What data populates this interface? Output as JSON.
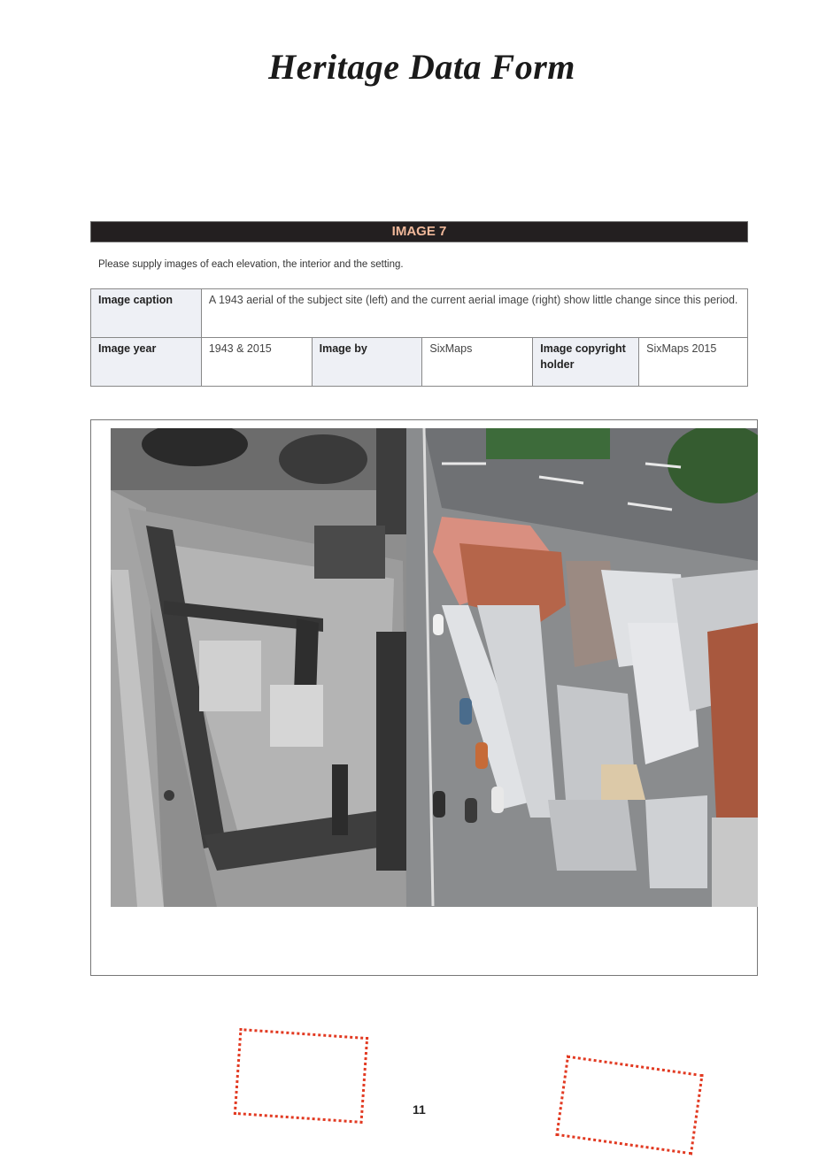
{
  "title": "Heritage Data Form",
  "section": {
    "heading": "IMAGE 7",
    "instruction": "Please supply images of each elevation, the interior and the setting."
  },
  "fields": {
    "caption_label": "Image caption",
    "caption_value": "A 1943 aerial of the subject site (left) and the current aerial image (right) show little change since this period.",
    "year_label": "Image year",
    "year_value": "1943 & 2015",
    "by_label": "Image by",
    "by_value": "SixMaps",
    "copyright_label": "Image copyright holder",
    "copyright_value": "SixMaps 2015"
  },
  "page_number": "11",
  "colors": {
    "section_bar_bg": "#231f20",
    "section_bar_text": "#f0b89a",
    "label_cell_bg": "#eef0f5",
    "stamp_outline": "#e23a22"
  }
}
